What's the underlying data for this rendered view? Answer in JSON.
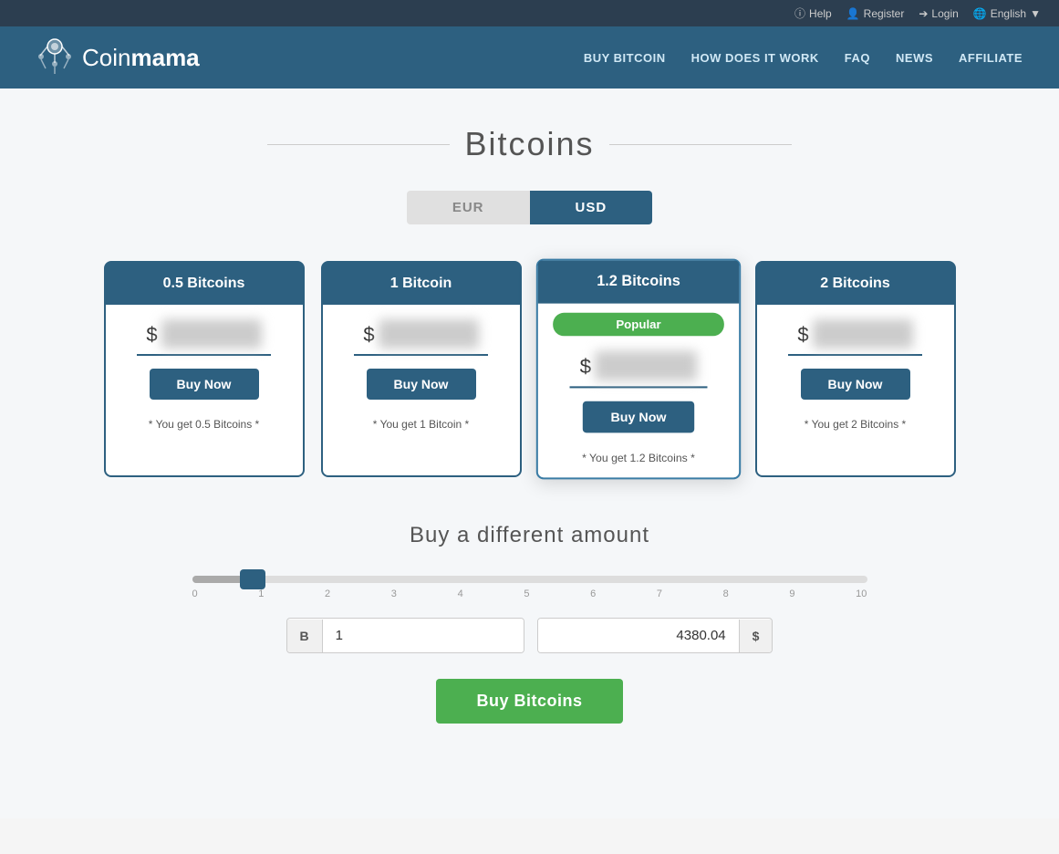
{
  "topbar": {
    "help": "Help",
    "register": "Register",
    "login": "Login",
    "language": "English"
  },
  "header": {
    "logo_text_coin": "Coin",
    "logo_text_mama": "mama",
    "nav": {
      "buy_bitcoin": "BUY BITCOIN",
      "how_it_works": "HOW DOES IT WORK",
      "faq": "FAQ",
      "news": "NEWS",
      "affiliate": "AFFILIATE"
    }
  },
  "page": {
    "title": "Bitcoins",
    "currency_eur": "EUR",
    "currency_usd": "USD"
  },
  "cards": [
    {
      "title": "0.5 Bitcoins",
      "dollar": "$",
      "buy_label": "Buy Now",
      "footer": "* You get 0.5 Bitcoins *",
      "featured": false,
      "popular": false
    },
    {
      "title": "1 Bitcoin",
      "dollar": "$",
      "buy_label": "Buy Now",
      "footer": "* You get 1 Bitcoin *",
      "featured": false,
      "popular": false
    },
    {
      "title": "1.2 Bitcoins",
      "dollar": "$",
      "buy_label": "Buy Now",
      "footer": "* You get 1.2 Bitcoins *",
      "featured": true,
      "popular": true,
      "popular_label": "Popular"
    },
    {
      "title": "2 Bitcoins",
      "dollar": "$",
      "buy_label": "Buy Now",
      "footer": "* You get 2 Bitcoins *",
      "featured": false,
      "popular": false
    }
  ],
  "different_amount": {
    "title": "Buy a different amount",
    "slider_labels": [
      "0",
      "1",
      "2",
      "3",
      "4",
      "5",
      "6",
      "7",
      "8",
      "9",
      "10"
    ],
    "btc_prefix": "B",
    "btc_value": "1",
    "usd_value": "4380.04",
    "usd_suffix": "$",
    "buy_button": "Buy Bitcoins"
  }
}
